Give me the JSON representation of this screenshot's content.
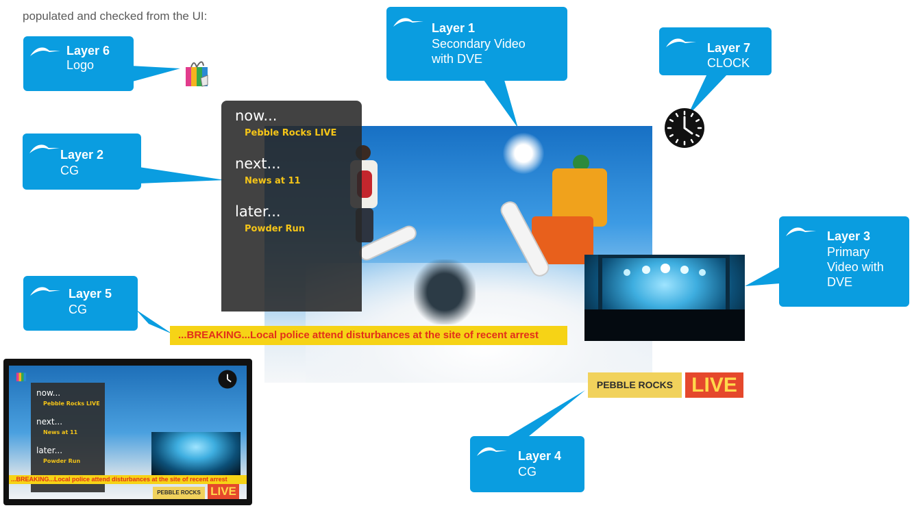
{
  "intro_text": "populated and checked from the UI:",
  "callouts": [
    {
      "id": "layer6",
      "title": "Layer 6",
      "desc_lines": [
        "Logo"
      ]
    },
    {
      "id": "layer1",
      "title": "Layer 1",
      "desc_lines": [
        "Secondary Video",
        "with DVE"
      ]
    },
    {
      "id": "layer7",
      "title": "Layer 7",
      "desc_lines": [
        "CLOCK"
      ]
    },
    {
      "id": "layer2",
      "title": "Layer 2",
      "desc_lines": [
        "CG"
      ]
    },
    {
      "id": "layer3",
      "title": "Layer 3",
      "desc_lines": [
        "Primary",
        "Video with",
        "DVE"
      ]
    },
    {
      "id": "layer5",
      "title": "Layer 5",
      "desc_lines": [
        "CG"
      ]
    },
    {
      "id": "layer4",
      "title": "Layer 4",
      "desc_lines": [
        "CG"
      ]
    }
  ],
  "schedule": {
    "now_label": "now...",
    "now_show": "Pebble Rocks LIVE",
    "next_label": "next...",
    "next_show": "News at 11",
    "later_label": "later...",
    "later_show": "Powder Run"
  },
  "ticker_text": "...BREAKING...Local police attend disturbances at the site of recent arrest",
  "pebble_tag": "PEBBLE ROCKS",
  "live_tag": "LIVE",
  "colors": {
    "callout_blue": "#0a9de0",
    "ticker_yellow": "#f6d316",
    "ticker_red": "#e22f1a",
    "schedule_gold": "#f5c518",
    "live_red": "#e5482c"
  },
  "icons": [
    "logo-gift-icon",
    "clock-icon",
    "callout-logo-icon"
  ]
}
